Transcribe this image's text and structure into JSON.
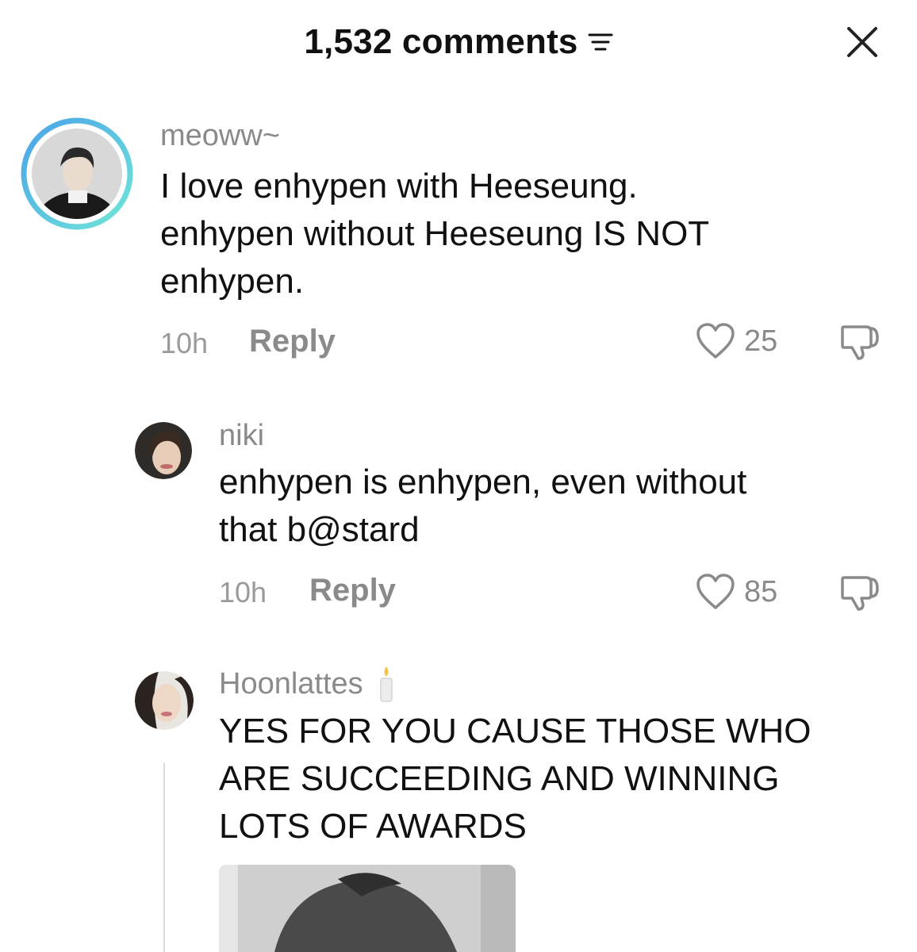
{
  "header": {
    "title": "1,532 comments",
    "sort_icon": "sort-lines-icon",
    "close_icon": "close-x-icon"
  },
  "comments": [
    {
      "username": "meoww~",
      "lines": [
        "I love enhypen with Heeseung.",
        "enhypen without Heeseung IS NOT",
        "enhypen."
      ],
      "time": "10h",
      "reply_label": "Reply",
      "likes": "25"
    },
    {
      "username": "niki",
      "lines": [
        "enhypen is enhypen, even without",
        "that b@stard"
      ],
      "time": "10h",
      "reply_label": "Reply",
      "likes": "85"
    },
    {
      "username": "Hoonlattes",
      "badge_icon": "candle-icon",
      "lines": [
        "YES FOR YOU CAUSE THOSE WHO",
        "ARE SUCCEEDING AND WINNING",
        "LOTS OF AWARDS"
      ]
    }
  ],
  "colors": {
    "text": "#111111",
    "muted": "#8a8a8a",
    "story_ring_start": "#6fd6e6",
    "story_ring_end": "#4aa3e8"
  }
}
